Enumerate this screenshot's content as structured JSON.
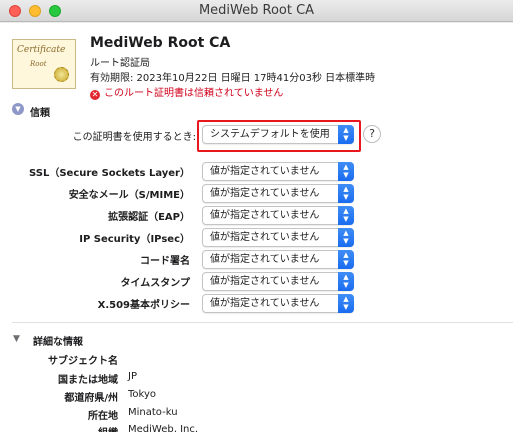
{
  "window": {
    "title": "MediWeb Root CA"
  },
  "certificate": {
    "icon_text": "Certificate",
    "icon_sub": "Root",
    "name": "MediWeb Root CA",
    "kind": "ルート認証局",
    "expiry": "有効期限: 2023年10月22日 日曜日 17時41分03秒 日本標準時",
    "warning": "このルート証明書は信頼されていません"
  },
  "trust": {
    "section_label": "信頼",
    "use_label": "この証明書を使用するとき:",
    "use_value": "システムデフォルトを使用",
    "help": "?",
    "rows": [
      {
        "label": "SSL（Secure Sockets Layer）",
        "value": "値が指定されていません"
      },
      {
        "label": "安全なメール（S/MIME）",
        "value": "値が指定されていません"
      },
      {
        "label": "拡張認証（EAP）",
        "value": "値が指定されていません"
      },
      {
        "label": "IP Security（IPsec）",
        "value": "値が指定されていません"
      },
      {
        "label": "コード署名",
        "value": "値が指定されていません"
      },
      {
        "label": "タイムスタンプ",
        "value": "値が指定されていません"
      },
      {
        "label": "X.509基本ポリシー",
        "value": "値が指定されていません"
      }
    ]
  },
  "details": {
    "section_label": "詳細な情報",
    "subject_label": "サブジェクト名",
    "fields": [
      {
        "label": "国または地域",
        "value": "JP"
      },
      {
        "label": "都道府県/州",
        "value": "Tokyo"
      },
      {
        "label": "所在地",
        "value": "Minato-ku"
      },
      {
        "label": "組織",
        "value": "MediWeb, Inc."
      }
    ]
  },
  "icons": {
    "trust_toggle": "disclosure-down-icon",
    "details_toggle": "disclosure-down-icon",
    "warning": "error-circle-icon"
  },
  "colors": {
    "accent": "#1a6cf0",
    "warning": "#d0021b",
    "highlight": "#e8161d"
  }
}
